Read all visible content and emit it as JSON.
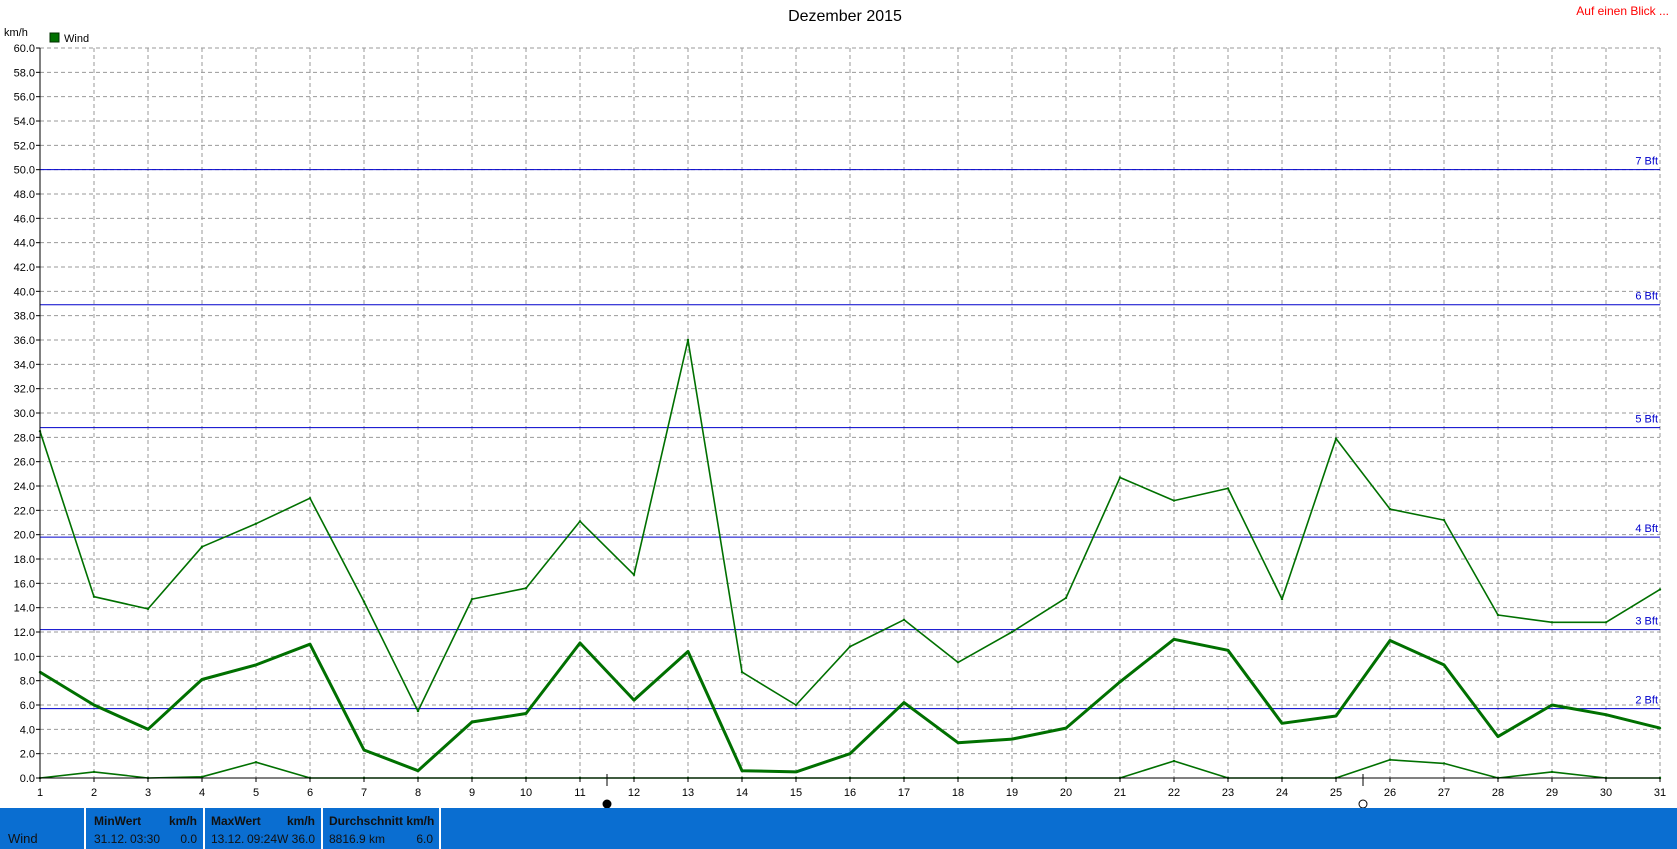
{
  "top_link": "Auf einen Blick ...",
  "chart_data": {
    "type": "line",
    "title": "Dezember 2015",
    "ylabel": "km/h",
    "legend": [
      "Wind"
    ],
    "ylim": [
      0,
      60
    ],
    "yticks": [
      "0.0",
      "2.0",
      "4.0",
      "6.0",
      "8.0",
      "10.0",
      "12.0",
      "14.0",
      "16.0",
      "18.0",
      "20.0",
      "22.0",
      "24.0",
      "26.0",
      "28.0",
      "30.0",
      "32.0",
      "34.0",
      "36.0",
      "38.0",
      "40.0",
      "42.0",
      "44.0",
      "46.0",
      "48.0",
      "50.0",
      "52.0",
      "54.0",
      "56.0",
      "58.0",
      "60.0"
    ],
    "categories": [
      "1",
      "2",
      "3",
      "4",
      "5",
      "6",
      "7",
      "8",
      "9",
      "10",
      "11",
      "12",
      "13",
      "14",
      "15",
      "16",
      "17",
      "18",
      "19",
      "20",
      "21",
      "22",
      "23",
      "24",
      "25",
      "26",
      "27",
      "28",
      "29",
      "30",
      "31"
    ],
    "grid": true,
    "series": [
      {
        "name": "Wind",
        "role": "max",
        "color": "#007000",
        "values": [
          28.5,
          14.9,
          13.9,
          19.0,
          20.9,
          23.0,
          14.5,
          5.5,
          14.7,
          15.6,
          21.1,
          16.7,
          36.0,
          8.7,
          6.0,
          10.8,
          13.0,
          9.5,
          12.0,
          14.8,
          24.7,
          22.8,
          23.8,
          14.7,
          27.9,
          22.1,
          21.2,
          13.4,
          12.8,
          12.8,
          15.5
        ]
      },
      {
        "name": "Wind",
        "role": "average",
        "color": "#007000",
        "values": [
          8.7,
          6.0,
          4.0,
          8.1,
          9.3,
          11.0,
          2.3,
          0.6,
          4.6,
          5.3,
          11.1,
          6.4,
          10.4,
          0.6,
          0.5,
          2.0,
          6.2,
          2.9,
          3.2,
          4.1,
          7.9,
          11.4,
          10.5,
          4.5,
          5.1,
          11.3,
          9.3,
          3.4,
          6.0,
          5.2,
          4.1
        ]
      },
      {
        "name": "Wind",
        "role": "min",
        "color": "#007000",
        "values": [
          0.0,
          0.5,
          0.0,
          0.1,
          1.3,
          0.0,
          0.0,
          0.0,
          0.0,
          0.0,
          0.0,
          0.0,
          0.0,
          0.0,
          0.0,
          0.0,
          0.0,
          0.0,
          0.0,
          0.0,
          0.0,
          1.4,
          0.0,
          0.0,
          0.0,
          1.5,
          1.2,
          0.0,
          0.5,
          0.0,
          0.0
        ]
      }
    ],
    "reference_lines": [
      {
        "label": "2 Bft",
        "value": 5.7,
        "color": "#0000cc"
      },
      {
        "label": "3 Bft",
        "value": 12.2,
        "color": "#0000cc"
      },
      {
        "label": "4 Bft",
        "value": 19.8,
        "color": "#0000cc"
      },
      {
        "label": "5 Bft",
        "value": 28.8,
        "color": "#0000cc"
      },
      {
        "label": "6 Bft",
        "value": 38.9,
        "color": "#0000cc"
      },
      {
        "label": "7 Bft",
        "value": 50.0,
        "color": "#0000cc"
      }
    ],
    "moon_markers": [
      {
        "phase": "full-moon",
        "day": 11.5
      },
      {
        "phase": "new-moon",
        "day": 25.5
      }
    ]
  },
  "footer": {
    "row_label": "Wind",
    "min": {
      "header": "MinWert",
      "unit": "km/h",
      "date": "31.12.",
      "time": "03:30",
      "value": "0.0"
    },
    "max": {
      "header": "MaxWert",
      "unit": "km/h",
      "date": "13.12.",
      "time": "09:24",
      "value": "W 36.0"
    },
    "avg": {
      "header": "Durchschnitt km/h",
      "distance": "8816.9 km",
      "value": "6.0"
    }
  }
}
